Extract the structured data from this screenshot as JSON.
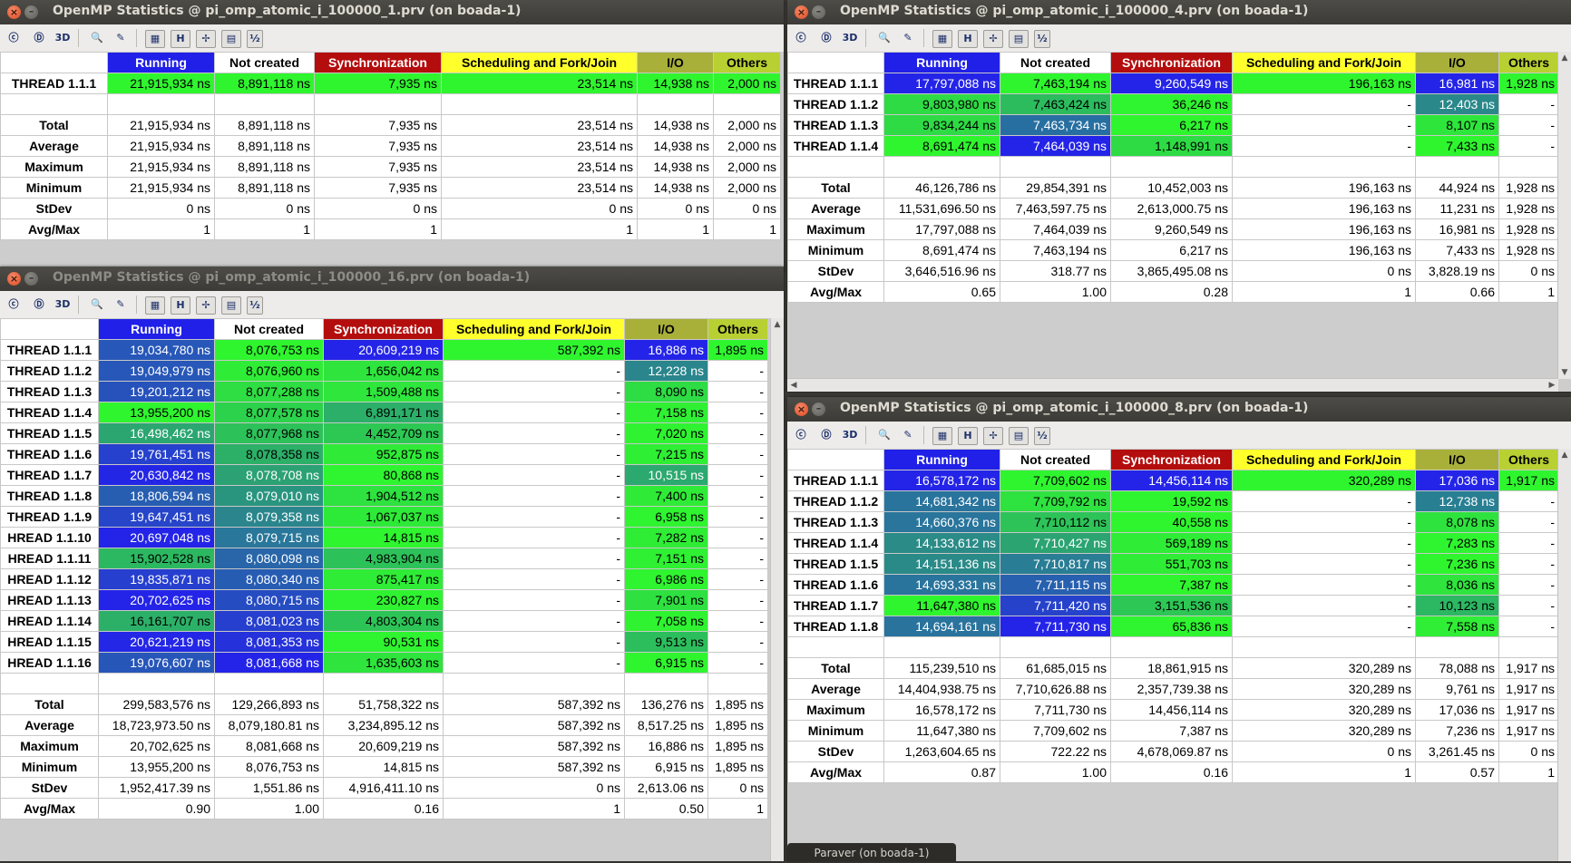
{
  "app": {
    "taskbar_label": "Paraver (on boada-1)"
  },
  "colors": {
    "running": "#2020e8",
    "not_created": "#24906c",
    "synchronization": "#b40d0d",
    "scheduling": "#ffff2c",
    "io": "#a8b03a",
    "others": "#b8d032"
  },
  "toolbar": {
    "icons": [
      "control-window-icon",
      "data-window-icon",
      "3d-icon",
      "zoom-icon",
      "refresh-icon",
      "gradient-icon",
      "horizontal-icon",
      "inactive-icon",
      "color-icon",
      "semantic-icon"
    ],
    "labels": [
      "ⓒ",
      "Ⓓ",
      "3D",
      "🔍",
      "✎",
      "▦",
      "H",
      "✢",
      "▤",
      "½"
    ]
  },
  "headers": [
    "Running",
    "Not created",
    "Synchronization",
    "Scheduling and Fork/Join",
    "I/O",
    "Others"
  ],
  "stat_labels": [
    "Total",
    "Average",
    "Maximum",
    "Minimum",
    "StDev",
    "Avg/Max"
  ],
  "windows": [
    {
      "title": "OpenMP Statistics @ pi_omp_atomic_i_100000_1.prv (on boada-1)",
      "threads": [
        {
          "name": "THREAD 1.1.1",
          "cells": [
            "21,915,934 ns",
            "8,891,118 ns",
            "7,935 ns",
            "23,514 ns",
            "14,938 ns",
            "2,000 ns"
          ]
        }
      ],
      "stats": [
        [
          "21,915,934 ns",
          "8,891,118 ns",
          "7,935 ns",
          "23,514 ns",
          "14,938 ns",
          "2,000 ns"
        ],
        [
          "21,915,934 ns",
          "8,891,118 ns",
          "7,935 ns",
          "23,514 ns",
          "14,938 ns",
          "2,000 ns"
        ],
        [
          "21,915,934 ns",
          "8,891,118 ns",
          "7,935 ns",
          "23,514 ns",
          "14,938 ns",
          "2,000 ns"
        ],
        [
          "21,915,934 ns",
          "8,891,118 ns",
          "7,935 ns",
          "23,514 ns",
          "14,938 ns",
          "2,000 ns"
        ],
        [
          "0 ns",
          "0 ns",
          "0 ns",
          "0 ns",
          "0 ns",
          "0 ns"
        ],
        [
          "1",
          "1",
          "1",
          "1",
          "1",
          "1"
        ]
      ]
    },
    {
      "title": "OpenMP Statistics @ pi_omp_atomic_i_100000_4.prv (on boada-1)",
      "threads": [
        {
          "name": "THREAD 1.1.1",
          "cells": [
            "17,797,088 ns",
            "7,463,194 ns",
            "9,260,549 ns",
            "196,163 ns",
            "16,981 ns",
            "1,928 ns"
          ]
        },
        {
          "name": "THREAD 1.1.2",
          "cells": [
            "9,803,980 ns",
            "7,463,424 ns",
            "36,246 ns",
            "-",
            "12,403 ns",
            "-"
          ]
        },
        {
          "name": "THREAD 1.1.3",
          "cells": [
            "9,834,244 ns",
            "7,463,734 ns",
            "6,217 ns",
            "-",
            "8,107 ns",
            "-"
          ]
        },
        {
          "name": "THREAD 1.1.4",
          "cells": [
            "8,691,474 ns",
            "7,464,039 ns",
            "1,148,991 ns",
            "-",
            "7,433 ns",
            "-"
          ]
        }
      ],
      "stats": [
        [
          "46,126,786 ns",
          "29,854,391 ns",
          "10,452,003 ns",
          "196,163 ns",
          "44,924 ns",
          "1,928 ns"
        ],
        [
          "11,531,696.50 ns",
          "7,463,597.75 ns",
          "2,613,000.75 ns",
          "196,163 ns",
          "11,231 ns",
          "1,928 ns"
        ],
        [
          "17,797,088 ns",
          "7,464,039 ns",
          "9,260,549 ns",
          "196,163 ns",
          "16,981 ns",
          "1,928 ns"
        ],
        [
          "8,691,474 ns",
          "7,463,194 ns",
          "6,217 ns",
          "196,163 ns",
          "7,433 ns",
          "1,928 ns"
        ],
        [
          "3,646,516.96 ns",
          "318.77 ns",
          "3,865,495.08 ns",
          "0 ns",
          "3,828.19 ns",
          "0 ns"
        ],
        [
          "0.65",
          "1.00",
          "0.28",
          "1",
          "0.66",
          "1"
        ]
      ]
    },
    {
      "title": "OpenMP Statistics @ pi_omp_atomic_i_100000_16.prv (on boada-1)",
      "threads": [
        {
          "name": "THREAD 1.1.1",
          "cells": [
            "19,034,780 ns",
            "8,076,753 ns",
            "20,609,219 ns",
            "587,392 ns",
            "16,886 ns",
            "1,895 ns"
          ]
        },
        {
          "name": "THREAD 1.1.2",
          "cells": [
            "19,049,979 ns",
            "8,076,960 ns",
            "1,656,042 ns",
            "-",
            "12,228 ns",
            "-"
          ]
        },
        {
          "name": "THREAD 1.1.3",
          "cells": [
            "19,201,212 ns",
            "8,077,288 ns",
            "1,509,488 ns",
            "-",
            "8,090 ns",
            "-"
          ]
        },
        {
          "name": "THREAD 1.1.4",
          "cells": [
            "13,955,200 ns",
            "8,077,578 ns",
            "6,891,171 ns",
            "-",
            "7,158 ns",
            "-"
          ]
        },
        {
          "name": "THREAD 1.1.5",
          "cells": [
            "16,498,462 ns",
            "8,077,968 ns",
            "4,452,709 ns",
            "-",
            "7,020 ns",
            "-"
          ]
        },
        {
          "name": "THREAD 1.1.6",
          "cells": [
            "19,761,451 ns",
            "8,078,358 ns",
            "952,875 ns",
            "-",
            "7,215 ns",
            "-"
          ]
        },
        {
          "name": "THREAD 1.1.7",
          "cells": [
            "20,630,842 ns",
            "8,078,708 ns",
            "80,868 ns",
            "-",
            "10,515 ns",
            "-"
          ]
        },
        {
          "name": "THREAD 1.1.8",
          "cells": [
            "18,806,594 ns",
            "8,079,010 ns",
            "1,904,512 ns",
            "-",
            "7,400 ns",
            "-"
          ]
        },
        {
          "name": "THREAD 1.1.9",
          "cells": [
            "19,647,451 ns",
            "8,079,358 ns",
            "1,067,037 ns",
            "-",
            "6,958 ns",
            "-"
          ]
        },
        {
          "name": "HREAD 1.1.10",
          "cells": [
            "20,697,048 ns",
            "8,079,715 ns",
            "14,815 ns",
            "-",
            "7,282 ns",
            "-"
          ]
        },
        {
          "name": "HREAD 1.1.11",
          "cells": [
            "15,902,528 ns",
            "8,080,098 ns",
            "4,983,904 ns",
            "-",
            "7,151 ns",
            "-"
          ]
        },
        {
          "name": "HREAD 1.1.12",
          "cells": [
            "19,835,871 ns",
            "8,080,340 ns",
            "875,417 ns",
            "-",
            "6,986 ns",
            "-"
          ]
        },
        {
          "name": "HREAD 1.1.13",
          "cells": [
            "20,702,625 ns",
            "8,080,715 ns",
            "230,827 ns",
            "-",
            "7,901 ns",
            "-"
          ]
        },
        {
          "name": "HREAD 1.1.14",
          "cells": [
            "16,161,707 ns",
            "8,081,023 ns",
            "4,803,304 ns",
            "-",
            "7,058 ns",
            "-"
          ]
        },
        {
          "name": "HREAD 1.1.15",
          "cells": [
            "20,621,219 ns",
            "8,081,353 ns",
            "90,531 ns",
            "-",
            "9,513 ns",
            "-"
          ]
        },
        {
          "name": "HREAD 1.1.16",
          "cells": [
            "19,076,607 ns",
            "8,081,668 ns",
            "1,635,603 ns",
            "-",
            "6,915 ns",
            "-"
          ]
        }
      ],
      "stats": [
        [
          "299,583,576 ns",
          "129,266,893 ns",
          "51,758,322 ns",
          "587,392 ns",
          "136,276 ns",
          "1,895 ns"
        ],
        [
          "18,723,973.50 ns",
          "8,079,180.81 ns",
          "3,234,895.12 ns",
          "587,392 ns",
          "8,517.25 ns",
          "1,895 ns"
        ],
        [
          "20,702,625 ns",
          "8,081,668 ns",
          "20,609,219 ns",
          "587,392 ns",
          "16,886 ns",
          "1,895 ns"
        ],
        [
          "13,955,200 ns",
          "8,076,753 ns",
          "14,815 ns",
          "587,392 ns",
          "6,915 ns",
          "1,895 ns"
        ],
        [
          "1,952,417.39 ns",
          "1,551.86 ns",
          "4,916,411.10 ns",
          "0 ns",
          "2,613.06 ns",
          "0 ns"
        ],
        [
          "0.90",
          "1.00",
          "0.16",
          "1",
          "0.50",
          "1"
        ]
      ]
    },
    {
      "title": "OpenMP Statistics @ pi_omp_atomic_i_100000_8.prv (on boada-1)",
      "threads": [
        {
          "name": "THREAD 1.1.1",
          "cells": [
            "16,578,172 ns",
            "7,709,602 ns",
            "14,456,114 ns",
            "320,289 ns",
            "17,036 ns",
            "1,917 ns"
          ]
        },
        {
          "name": "THREAD 1.1.2",
          "cells": [
            "14,681,342 ns",
            "7,709,792 ns",
            "19,592 ns",
            "-",
            "12,738 ns",
            "-"
          ]
        },
        {
          "name": "THREAD 1.1.3",
          "cells": [
            "14,660,376 ns",
            "7,710,112 ns",
            "40,558 ns",
            "-",
            "8,078 ns",
            "-"
          ]
        },
        {
          "name": "THREAD 1.1.4",
          "cells": [
            "14,133,612 ns",
            "7,710,427 ns",
            "569,189 ns",
            "-",
            "7,283 ns",
            "-"
          ]
        },
        {
          "name": "THREAD 1.1.5",
          "cells": [
            "14,151,136 ns",
            "7,710,817 ns",
            "551,703 ns",
            "-",
            "7,236 ns",
            "-"
          ]
        },
        {
          "name": "THREAD 1.1.6",
          "cells": [
            "14,693,331 ns",
            "7,711,115 ns",
            "7,387 ns",
            "-",
            "8,036 ns",
            "-"
          ]
        },
        {
          "name": "THREAD 1.1.7",
          "cells": [
            "11,647,380 ns",
            "7,711,420 ns",
            "3,151,536 ns",
            "-",
            "10,123 ns",
            "-"
          ]
        },
        {
          "name": "THREAD 1.1.8",
          "cells": [
            "14,694,161 ns",
            "7,711,730 ns",
            "65,836 ns",
            "-",
            "7,558 ns",
            "-"
          ]
        }
      ],
      "stats": [
        [
          "115,239,510 ns",
          "61,685,015 ns",
          "18,861,915 ns",
          "320,289 ns",
          "78,088 ns",
          "1,917 ns"
        ],
        [
          "14,404,938.75 ns",
          "7,710,626.88 ns",
          "2,357,739.38 ns",
          "320,289 ns",
          "9,761 ns",
          "1,917 ns"
        ],
        [
          "16,578,172 ns",
          "7,711,730 ns",
          "14,456,114 ns",
          "320,289 ns",
          "17,036 ns",
          "1,917 ns"
        ],
        [
          "11,647,380 ns",
          "7,709,602 ns",
          "7,387 ns",
          "320,289 ns",
          "7,236 ns",
          "1,917 ns"
        ],
        [
          "1,263,604.65 ns",
          "722.22 ns",
          "4,678,069.87 ns",
          "0 ns",
          "3,261.45 ns",
          "0 ns"
        ],
        [
          "0.87",
          "1.00",
          "0.16",
          "1",
          "0.57",
          "1"
        ]
      ]
    }
  ]
}
